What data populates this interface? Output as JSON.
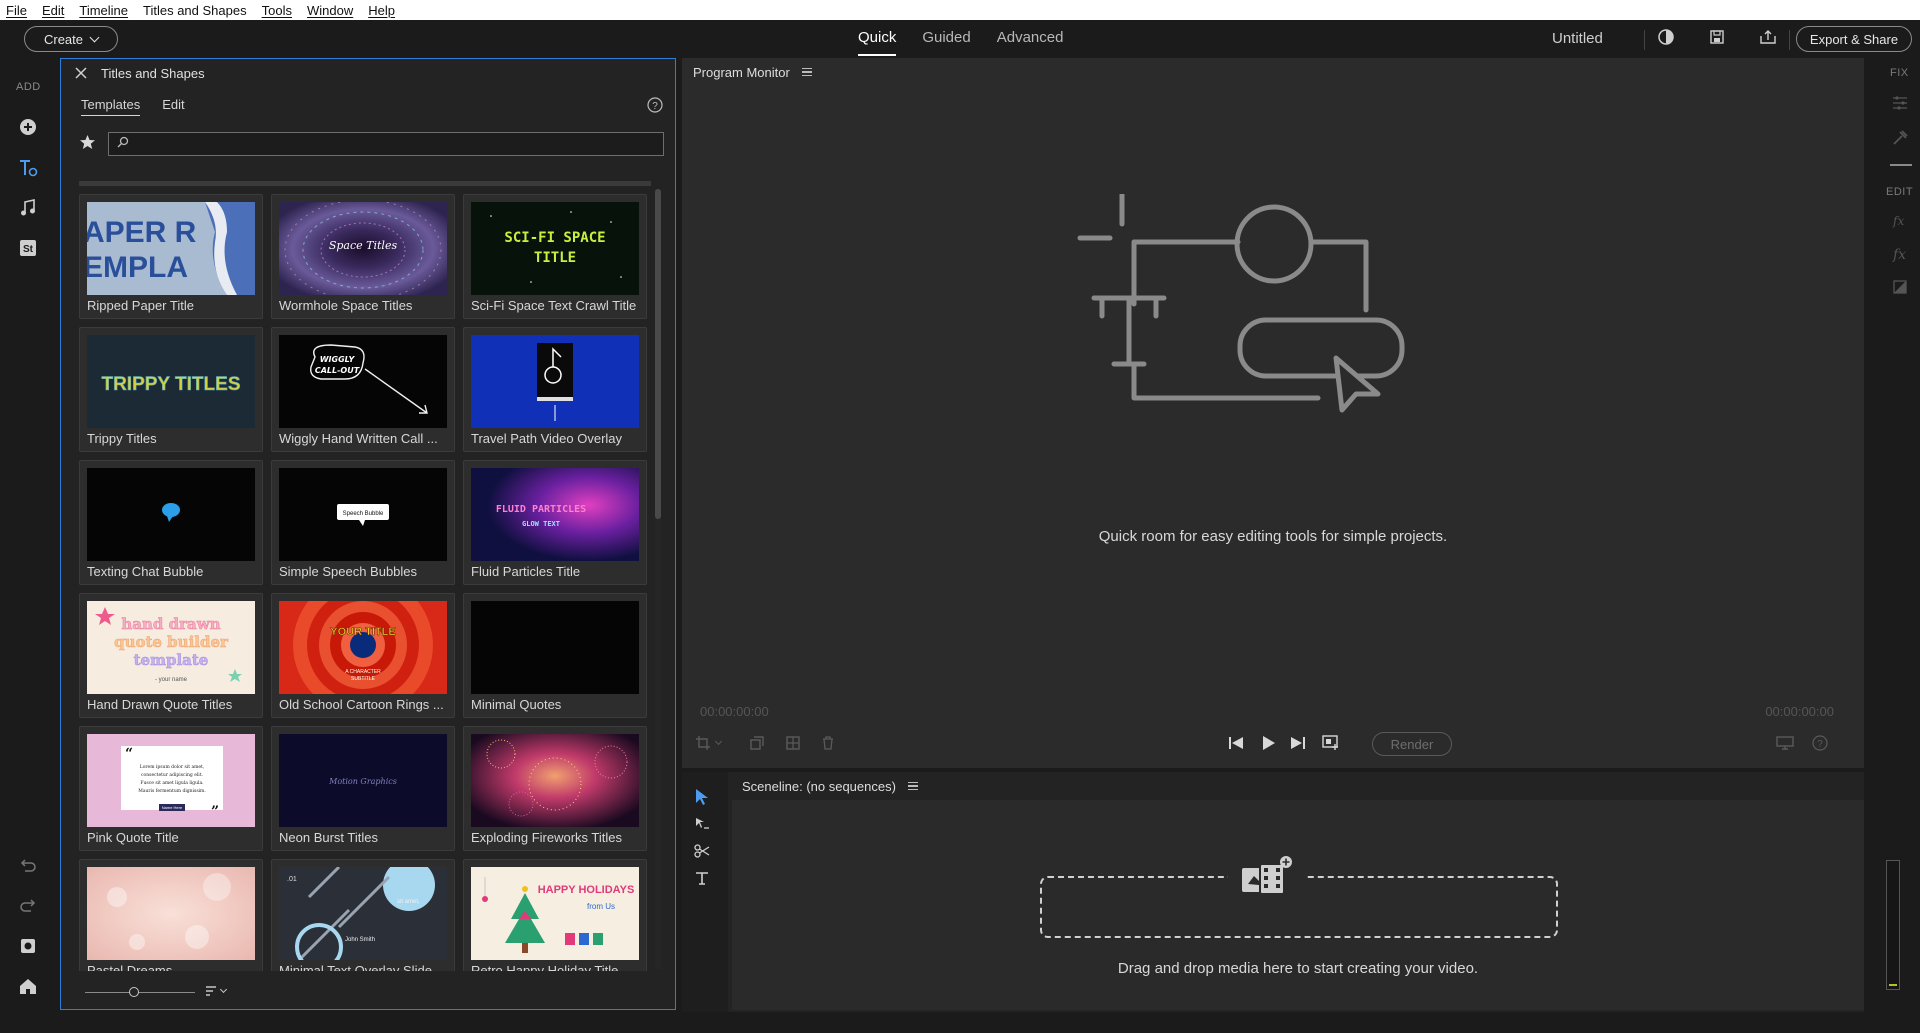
{
  "menu": [
    "File",
    "Edit",
    "Timeline",
    "Titles and Shapes",
    "Tools",
    "Window",
    "Help"
  ],
  "topbar": {
    "create_label": "Create",
    "modes": [
      "Quick",
      "Guided",
      "Advanced"
    ],
    "active_mode": "Quick",
    "project_title": "Untitled",
    "export_label": "Export & Share"
  },
  "left_rail": {
    "add_label": "ADD"
  },
  "titles_panel": {
    "title": "Titles and Shapes",
    "tabs": [
      "Templates",
      "Edit"
    ],
    "active_tab": "Templates",
    "search_placeholder": "",
    "templates": [
      {
        "name": "Ripped Paper Title",
        "thumb": "ripped-paper"
      },
      {
        "name": "Wormhole Space Titles",
        "thumb": "wormhole"
      },
      {
        "name": "Sci-Fi Space Text Crawl Title",
        "thumb": "scifi"
      },
      {
        "name": "Trippy Titles",
        "thumb": "trippy"
      },
      {
        "name": "Wiggly Hand Written Call ...",
        "thumb": "wiggly"
      },
      {
        "name": "Travel Path Video Overlay",
        "thumb": "travel"
      },
      {
        "name": "Texting Chat Bubble",
        "thumb": "texting"
      },
      {
        "name": "Simple Speech Bubbles",
        "thumb": "speech"
      },
      {
        "name": "Fluid Particles Title",
        "thumb": "fluid"
      },
      {
        "name": "Hand Drawn Quote Titles",
        "thumb": "handdrawn"
      },
      {
        "name": "Old School Cartoon Rings ...",
        "thumb": "cartoon"
      },
      {
        "name": "Minimal Quotes",
        "thumb": "minimal"
      },
      {
        "name": "Pink Quote Title",
        "thumb": "pink"
      },
      {
        "name": "Neon Burst Titles",
        "thumb": "neon"
      },
      {
        "name": "Exploding Fireworks Titles",
        "thumb": "fireworks"
      },
      {
        "name": "Pastel Dreams",
        "thumb": "pastel"
      },
      {
        "name": "Minimal Text Overlay Slide...",
        "thumb": "overlay"
      },
      {
        "name": "Retro Happy Holiday Title",
        "thumb": "holiday"
      }
    ],
    "thumb_text": {
      "ripped_paper": "APER R\nEMPLA",
      "wormhole": "Space Titles",
      "scifi_1": "SCI-FI SPACE",
      "scifi_2": "TITLE",
      "trippy": "TRIPPY TITLES",
      "wiggly_1": "WIGGLY",
      "wiggly_2": "CALL-OUT",
      "speech": "Speech Bubble",
      "fluid_1": "FLUID PARTICLES",
      "fluid_2": "GLOW TEXT",
      "handdrawn_1": "hand drawn",
      "handdrawn_2": "quote builder",
      "handdrawn_3": "template",
      "handdrawn_4": "- your name",
      "cartoon_1": "YOUR TITLE",
      "cartoon_2": "A CHARACTER",
      "cartoon_3": "SUBTITLE",
      "pink_quote": "Lorem ipsum dolor sit amet, consectetur adipiscing elit.",
      "pink_name": "Name Here",
      "neon": "Motion Graphics",
      "overlay_1": ".01",
      "overlay_2": "sit amet,",
      "overlay_3": "John Smith",
      "holiday_1": "HAPPY HOLIDAYS",
      "holiday_2": "from Us"
    }
  },
  "monitor": {
    "title": "Program Monitor",
    "message": "Quick room for easy editing tools for simple projects.",
    "timecode_left": "00:00:00:00",
    "timecode_right": "00:00:00:00",
    "render_label": "Render"
  },
  "sceneline": {
    "title": "Sceneline: (no sequences)",
    "drop_message": "Drag and drop media here to start creating your video."
  },
  "right_rail": {
    "fix_label": "FIX",
    "edit_label": "EDIT"
  },
  "colors": {
    "accent": "#2f7fd8",
    "background": "#1b1b1b",
    "panel": "#232323"
  }
}
